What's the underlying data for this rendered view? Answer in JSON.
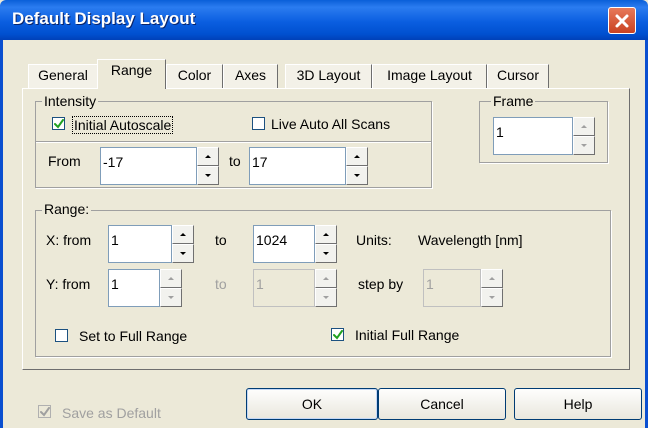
{
  "window": {
    "title": "Default Display Layout"
  },
  "tabs": [
    {
      "label": "General"
    },
    {
      "label": "Range",
      "active": true
    },
    {
      "label": "Color"
    },
    {
      "label": "Axes"
    },
    {
      "label": "3D Layout"
    },
    {
      "label": "Image Layout"
    },
    {
      "label": "Cursor"
    }
  ],
  "intensity": {
    "legend": "Intensity",
    "initial_autoscale": {
      "label": "Initial Autoscale",
      "checked": true
    },
    "live_auto": {
      "label": "Live Auto All Scans",
      "checked": false
    },
    "from_label": "From",
    "from_value": "-17",
    "to_label": "to",
    "to_value": "17"
  },
  "frame": {
    "legend": "Frame",
    "value": "1"
  },
  "range": {
    "legend": "Range:",
    "x_from_label": "X: from",
    "x_from_value": "1",
    "x_to_label": "to",
    "x_to_value": "1024",
    "units_label": "Units:",
    "units_value": "Wavelength [nm]",
    "y_from_label": "Y: from",
    "y_from_value": "1",
    "y_to_label": "to",
    "y_to_value": "1",
    "step_label": "step by",
    "step_value": "1",
    "set_full": {
      "label": "Set to Full Range",
      "checked": false
    },
    "initial_full": {
      "label": "Initial Full Range",
      "checked": true
    }
  },
  "footer": {
    "save_default": {
      "label": "Save as Default",
      "checked": true,
      "disabled": true
    },
    "ok_label": "OK",
    "cancel_label": "Cancel",
    "help_label": "Help"
  },
  "colors": {
    "titlebar": "#0a5ee0",
    "close": "#c94222",
    "face": "#ece9d8"
  }
}
